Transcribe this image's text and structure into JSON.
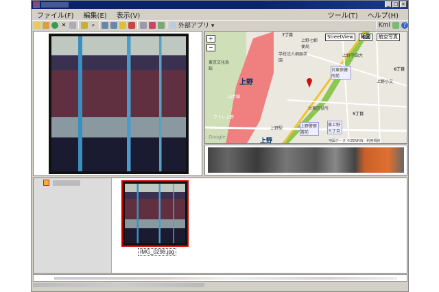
{
  "window": {
    "minimize": "_",
    "maximize": "□",
    "close": "×"
  },
  "menu": {
    "file": "ファイル(F)",
    "edit": "編集(E)",
    "view": "表示(V)",
    "tools": "ツール(T)",
    "help": "ヘルプ(H)"
  },
  "toolbar": {
    "external_apps": "外部アプリ ▾",
    "kml": "Kml"
  },
  "map": {
    "streetview": "StreetView",
    "map_tab": "地図",
    "satellite_tab": "航空写真",
    "zoom_in": "+",
    "zoom_out": "−",
    "labels": [
      "上野",
      "東京文化会館",
      "学校法人桐朋学園",
      "台東保健所前",
      "上野小文",
      "台東区役所",
      "5丁目",
      "6丁目",
      "7丁目",
      "上野警察署前",
      "東上野三丁目",
      "上野駅",
      "上野",
      "アトレ上野",
      "山手線",
      "上野学園大",
      "上野七郵便局"
    ],
    "attribution": "地図データ ©ZENRIN · 利用規約",
    "google": "Google"
  },
  "thumbnails": [
    {
      "filename": "IMG_0298.jpg"
    }
  ]
}
